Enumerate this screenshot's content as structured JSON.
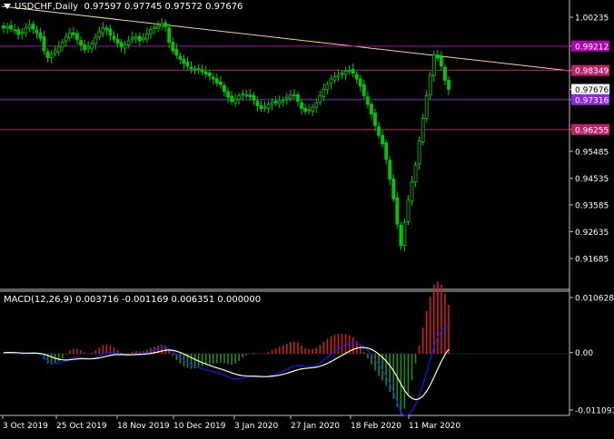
{
  "header": {
    "symbol": "USDCHF,Daily",
    "ohlc": "0.97597 0.97745 0.97572 0.97676"
  },
  "indicator": {
    "label": "MACD(12,26,9)",
    "values": "0.003716 -0.001169 0.006351 0.000000"
  },
  "price_scale": [
    "1.00235",
    "0.99212",
    "0.98349",
    "0.97676",
    "0.97316",
    "0.96255",
    "0.95485",
    "0.94535",
    "0.93585",
    "0.92635",
    "0.91685"
  ],
  "macd_scale": [
    "0.010628",
    "0.00",
    "-0.011093"
  ],
  "time_scale": [
    "3 Oct 2019",
    "25 Oct 2019",
    "18 Nov 2019",
    "10 Dec 2019",
    "3 Jan 2020",
    "27 Jan 2020",
    "18 Feb 2020",
    "11 Mar 2020"
  ],
  "levels": [
    {
      "value": "0.99212",
      "color": "#b000b0"
    },
    {
      "value": "0.98349",
      "color": "#c0206a"
    },
    {
      "value": "0.97316",
      "color": "#8a2be2"
    },
    {
      "value": "0.96255",
      "color": "#c0206a"
    }
  ],
  "current_price": "0.97676",
  "colors": {
    "bull": "#00c800",
    "bear": "#00c800",
    "signal": "#ffffcc",
    "macd": "#1515ff",
    "hist_up": "#c81e1e",
    "hist_down": "#1e8c1e",
    "trend": "#ffd080",
    "axis": "#c0c0c0"
  },
  "chart_data": {
    "type": "candlestick",
    "symbol": "USDCHF",
    "timeframe": "Daily",
    "close": [
      0.9985,
      0.999,
      0.9982,
      0.9979,
      0.9962,
      0.997,
      0.9985,
      0.9995,
      0.9982,
      0.9968,
      0.995,
      0.9905,
      0.988,
      0.9892,
      0.9905,
      0.9918,
      0.9935,
      0.9955,
      0.9968,
      0.9962,
      0.9945,
      0.9925,
      0.9908,
      0.9918,
      0.993,
      0.995,
      0.9972,
      0.9985,
      0.9978,
      0.996,
      0.9945,
      0.993,
      0.9918,
      0.9925,
      0.994,
      0.9952,
      0.9955,
      0.994,
      0.995,
      0.9965,
      0.998,
      0.9988,
      0.9992,
      1.0,
      0.999,
      0.9935,
      0.9905,
      0.989,
      0.9875,
      0.986,
      0.985,
      0.984,
      0.9838,
      0.9842,
      0.983,
      0.9822,
      0.9815,
      0.9805,
      0.979,
      0.9785,
      0.976,
      0.974,
      0.9725,
      0.9732,
      0.9745,
      0.9752,
      0.9748,
      0.9742,
      0.973,
      0.971,
      0.97,
      0.9705,
      0.9715,
      0.9722,
      0.972,
      0.9725,
      0.973,
      0.974,
      0.9748,
      0.9745,
      0.9725,
      0.97,
      0.969,
      0.9695,
      0.9705,
      0.972,
      0.9745,
      0.9768,
      0.9785,
      0.9805,
      0.9812,
      0.9818,
      0.9825,
      0.9832,
      0.9835,
      0.9825,
      0.9805,
      0.978,
      0.9745,
      0.9715,
      0.968,
      0.964,
      0.9605,
      0.9575,
      0.952,
      0.945,
      0.938,
      0.929,
      0.9215,
      0.9295,
      0.9375,
      0.944,
      0.95,
      0.9585,
      0.9665,
      0.9745,
      0.982,
      0.989,
      0.9878,
      0.985,
      0.98,
      0.9768
    ]
  }
}
